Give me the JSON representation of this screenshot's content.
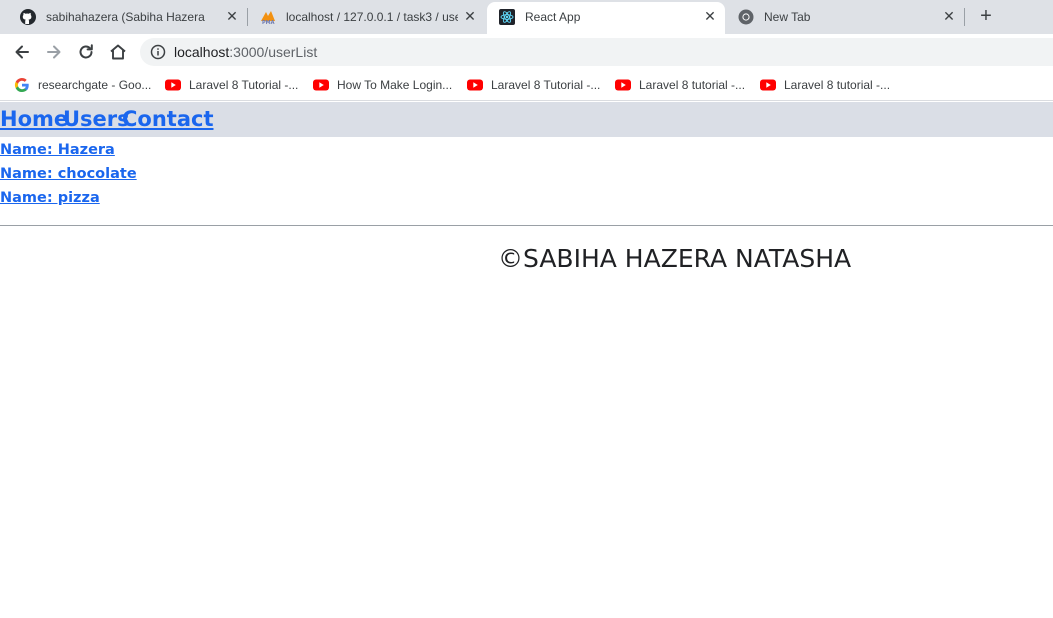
{
  "browser": {
    "tabs": [
      {
        "title": "sabihahazera (Sabiha Hazera )",
        "icon": "github-icon",
        "active": false
      },
      {
        "title": "localhost / 127.0.0.1 / task3 / use",
        "icon": "phpmyadmin-icon",
        "active": false
      },
      {
        "title": "React App",
        "icon": "react-icon",
        "active": true
      },
      {
        "title": "New Tab",
        "icon": "chrome-icon",
        "active": false
      }
    ],
    "address": {
      "host": "localhost",
      "path": ":3000/userList"
    },
    "bookmarks": [
      {
        "label": "researchgate - Goo...",
        "icon": "google-icon"
      },
      {
        "label": "Laravel 8 Tutorial -...",
        "icon": "youtube-icon"
      },
      {
        "label": "How To Make Login...",
        "icon": "youtube-icon"
      },
      {
        "label": "Laravel 8 Tutorial -...",
        "icon": "youtube-icon"
      },
      {
        "label": "Laravel 8 tutorial -...",
        "icon": "youtube-icon"
      },
      {
        "label": "Laravel 8 tutorial -...",
        "icon": "youtube-icon"
      }
    ]
  },
  "app": {
    "nav": {
      "home": "Home",
      "users": "Users",
      "contact": "Contact"
    },
    "users": [
      {
        "label": "Name: Hazera"
      },
      {
        "label": "Name: chocolate"
      },
      {
        "label": "Name: pizza"
      }
    ],
    "footer": "©SABIHA HAZERA NATASHA",
    "link_color": "#1a66ee"
  }
}
